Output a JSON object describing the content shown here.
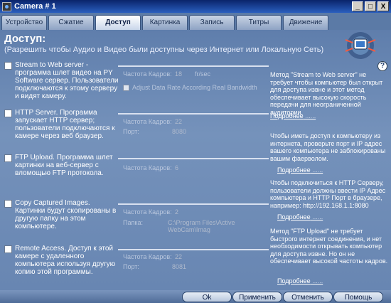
{
  "window": {
    "title": "Camera # 1",
    "controls": {
      "minimize": "_",
      "maximize": "□",
      "close": "X"
    }
  },
  "tabs": [
    {
      "label": "Устройство",
      "active": false
    },
    {
      "label": "Сжатие",
      "active": false
    },
    {
      "label": "Доступ",
      "active": true
    },
    {
      "label": "Картинка",
      "active": false
    },
    {
      "label": "Запись",
      "active": false
    },
    {
      "label": "Титры",
      "active": false
    },
    {
      "label": "Движение",
      "active": false
    }
  ],
  "header": {
    "title": "Доступ:",
    "subtitle": "(Разрешить чтобы Аудио и Видео были доступны через Интернет или Локальную Сеть)"
  },
  "sections": [
    {
      "desc": "Stream to Web server - программа шлет видео на PY Software сервер. Пользователи подключаются к этому серверу и видят камеру.",
      "fields": [
        {
          "label": "Частота Кадров:",
          "value": "18",
          "unit": "fr/sec"
        }
      ],
      "option": "Adjust Data Rate According Real Bandwidth"
    },
    {
      "desc": "HTTP Server. Программа запускает HTTP сервер; пользователи подключаются к камере через веб браузер.",
      "fields": [
        {
          "label": "Частота Кадров:",
          "value": "22"
        },
        {
          "label": "Порт:",
          "value": "8080"
        }
      ]
    },
    {
      "desc": "FTP Upload. Программа шлет картинки на веб-сервер с вломощью FTP протокола.",
      "fields": [
        {
          "label": "Частота Кадров:",
          "value": "6"
        }
      ]
    },
    {
      "desc": "Copy Captured Images. Картинки будут скопированы в другую папку на этом компьютере.",
      "fields": [
        {
          "label": "Частота Кадров:",
          "value": "2"
        },
        {
          "label": "Папка:",
          "value": "C:\\Program Files\\Active WebCam\\Imag"
        }
      ]
    },
    {
      "desc": "Remote Access. Доступ к этой камере с удаленного компьютера используя другую копию этой программы.",
      "fields": [
        {
          "label": "Частота Кадров:",
          "value": "22"
        },
        {
          "label": "Порт:",
          "value": "8081"
        }
      ]
    }
  ],
  "info": [
    "Метод \"Stream to Web server\" не требует чтобы компьютер был открыт для доступа извне и этот метод обеспечивает высокую скорость передачи для неограниченной аудитории.",
    "Чтобы иметь доступ к компьютеру из интернета, проверьте порт и IP адрес вашего компьютера не заблокированы вашим фаерволом.",
    "Чтобы подключиться к HTTP Серверу, пользователи должны ввести IP Адрес компьютера и HTTP Порт в браузере, например: http://192.168.1.1:8080",
    "Метод \"FTP Upload\" не требует быстрого интернет соединения, и нет необходимости открывать компьютер для доступа извне. Но он не обеспечивает высокой частоты кадров."
  ],
  "more_label": "Подробнее",
  "footer": {
    "ok": "Ok",
    "apply": "Применить",
    "cancel": "Отменить",
    "help": "Помощь"
  },
  "help_icon": "?",
  "colors": {
    "accent": "#0a246a",
    "panel": "#6a86ae"
  }
}
